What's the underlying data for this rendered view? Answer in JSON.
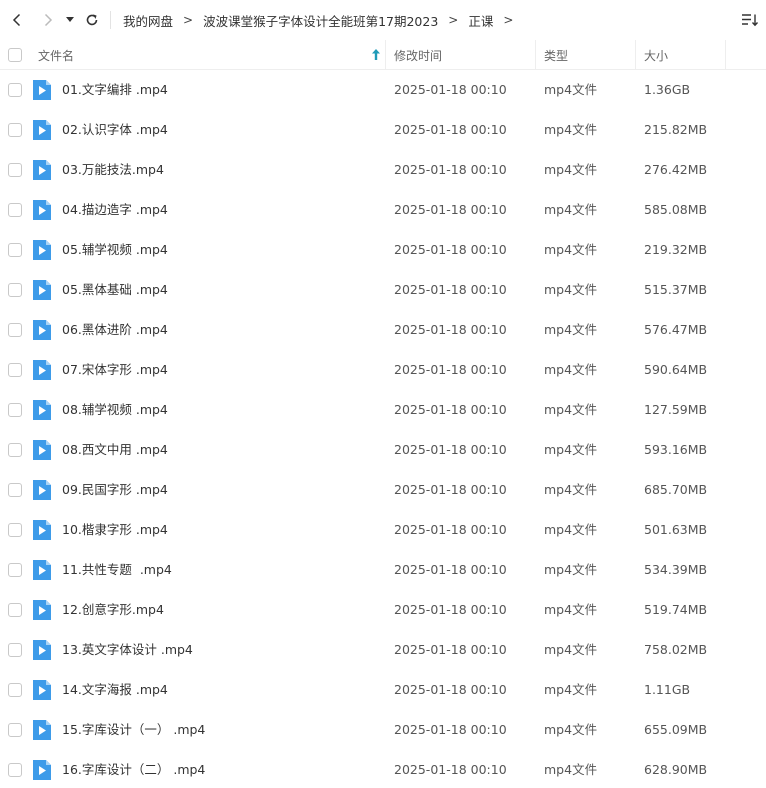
{
  "toolbar": {
    "back_icon": "chevron-left-icon",
    "forward_icon": "chevron-right-icon",
    "history_icon": "caret-down-icon",
    "refresh_icon": "refresh-icon",
    "sort_icon": "sort-list-icon"
  },
  "breadcrumb": [
    "我的网盘",
    "波波课堂猴子字体设计全能班第17期2023",
    "正课"
  ],
  "columns": {
    "name": "文件名",
    "modified": "修改时间",
    "type": "类型",
    "size": "大小"
  },
  "colors": {
    "file_icon": "#3d9be9",
    "sort_arrow": "#1f9bb8"
  },
  "files": [
    {
      "name": "01.文字编排 .mp4",
      "modified": "2025-01-18 00:10",
      "type": "mp4文件",
      "size": "1.36GB"
    },
    {
      "name": "02.认识字体 .mp4",
      "modified": "2025-01-18 00:10",
      "type": "mp4文件",
      "size": "215.82MB"
    },
    {
      "name": "03.万能技法.mp4",
      "modified": "2025-01-18 00:10",
      "type": "mp4文件",
      "size": "276.42MB"
    },
    {
      "name": "04.描边造字 .mp4",
      "modified": "2025-01-18 00:10",
      "type": "mp4文件",
      "size": "585.08MB"
    },
    {
      "name": "05.辅学视频 .mp4",
      "modified": "2025-01-18 00:10",
      "type": "mp4文件",
      "size": "219.32MB"
    },
    {
      "name": "05.黑体基础 .mp4",
      "modified": "2025-01-18 00:10",
      "type": "mp4文件",
      "size": "515.37MB"
    },
    {
      "name": "06.黑体进阶 .mp4",
      "modified": "2025-01-18 00:10",
      "type": "mp4文件",
      "size": "576.47MB"
    },
    {
      "name": "07.宋体字形 .mp4",
      "modified": "2025-01-18 00:10",
      "type": "mp4文件",
      "size": "590.64MB"
    },
    {
      "name": "08.辅学视频 .mp4",
      "modified": "2025-01-18 00:10",
      "type": "mp4文件",
      "size": "127.59MB"
    },
    {
      "name": "08.西文中用 .mp4",
      "modified": "2025-01-18 00:10",
      "type": "mp4文件",
      "size": "593.16MB"
    },
    {
      "name": "09.民国字形 .mp4",
      "modified": "2025-01-18 00:10",
      "type": "mp4文件",
      "size": "685.70MB"
    },
    {
      "name": "10.楷隶字形 .mp4",
      "modified": "2025-01-18 00:10",
      "type": "mp4文件",
      "size": "501.63MB"
    },
    {
      "name": "11.共性专题  .mp4",
      "modified": "2025-01-18 00:10",
      "type": "mp4文件",
      "size": "534.39MB"
    },
    {
      "name": "12.创意字形.mp4",
      "modified": "2025-01-18 00:10",
      "type": "mp4文件",
      "size": "519.74MB"
    },
    {
      "name": "13.英文字体设计 .mp4",
      "modified": "2025-01-18 00:10",
      "type": "mp4文件",
      "size": "758.02MB"
    },
    {
      "name": "14.文字海报 .mp4",
      "modified": "2025-01-18 00:10",
      "type": "mp4文件",
      "size": "1.11GB"
    },
    {
      "name": "15.字库设计（一） .mp4",
      "modified": "2025-01-18 00:10",
      "type": "mp4文件",
      "size": "655.09MB"
    },
    {
      "name": "16.字库设计（二） .mp4",
      "modified": "2025-01-18 00:10",
      "type": "mp4文件",
      "size": "628.90MB"
    }
  ]
}
